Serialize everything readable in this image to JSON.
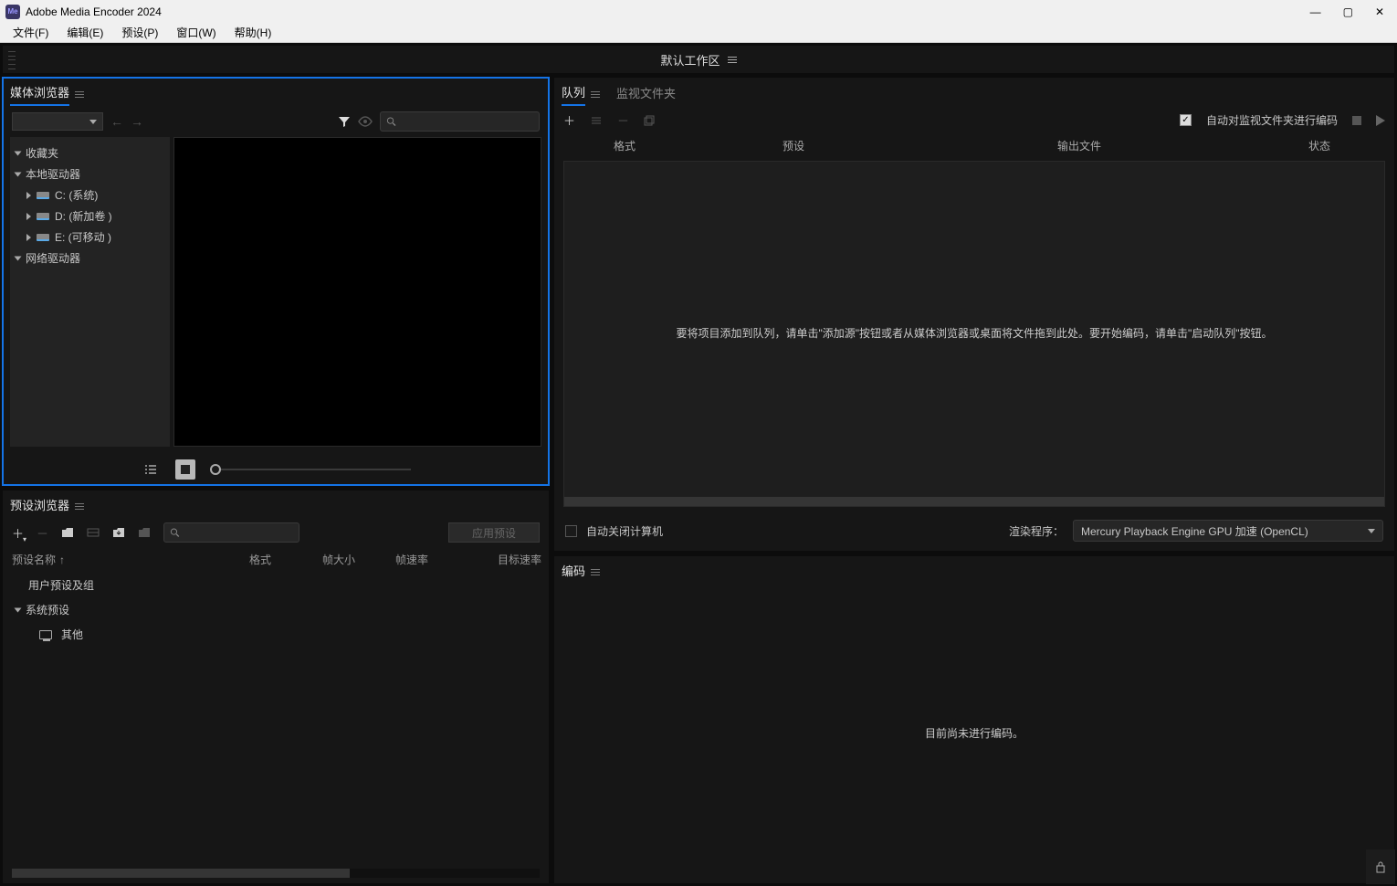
{
  "titlebar": {
    "title": "Adobe Media Encoder 2024",
    "app_icon_text": "Me"
  },
  "menubar": {
    "file": "文件(F)",
    "edit": "编辑(E)",
    "preset": "预设(P)",
    "window": "窗口(W)",
    "help": "帮助(H)"
  },
  "workspace": {
    "label": "默认工作区"
  },
  "media_browser": {
    "tab_label": "媒体浏览器",
    "tree": {
      "favorites": "收藏夹",
      "local_drives": "本地驱动器",
      "c_drive": "C: (系统)",
      "d_drive": "D: (新加卷 )",
      "e_drive": "E: (可移动 )",
      "network_drives": "网络驱动器"
    }
  },
  "preset_browser": {
    "tab_label": "预设浏览器",
    "apply_btn": "应用预设",
    "cols": {
      "name": "预设名称",
      "format": "格式",
      "frame_size": "帧大小",
      "frame_rate": "帧速率",
      "target_rate": "目标速率"
    },
    "sort_arrow": "↑",
    "user_presets": "用户预设及组",
    "system_presets": "系统预设",
    "other": "其他"
  },
  "queue": {
    "tab_queue": "队列",
    "tab_watch": "监视文件夹",
    "auto_encode_label": "自动对监视文件夹进行编码",
    "cols": {
      "format": "格式",
      "preset": "预设",
      "output": "输出文件",
      "status": "状态"
    },
    "empty_text": "要将项目添加到队列，请单击\"添加源\"按钮或者从媒体浏览器或桌面将文件拖到此处。要开始编码，请单击\"启动队列\"按钮。",
    "auto_shutdown_label": "自动关闭计算机",
    "renderer_label": "渲染程序：",
    "renderer_value": "Mercury Playback Engine GPU 加速 (OpenCL)"
  },
  "encoding": {
    "tab_label": "编码",
    "empty_text": "目前尚未进行编码。"
  }
}
